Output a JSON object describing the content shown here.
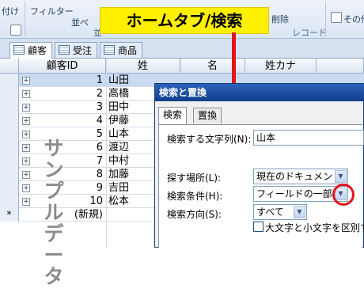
{
  "ribbon": {
    "left_text": "付け",
    "filter_label": "フィルター",
    "sort_label": "並べ",
    "group_label": "並",
    "delete_label": "削除",
    "record_group": "レコード",
    "find_partial": "その他"
  },
  "tabs": [
    {
      "label": "顧客"
    },
    {
      "label": "受注"
    },
    {
      "label": "商品"
    }
  ],
  "grid": {
    "headers": [
      "顧客ID",
      "姓",
      "名",
      "姓カナ"
    ],
    "new_row_label": "(新規)",
    "new_row_marker": "*",
    "rows": [
      {
        "id": "1",
        "last": "山田"
      },
      {
        "id": "2",
        "last": "高橋"
      },
      {
        "id": "3",
        "last": "田中"
      },
      {
        "id": "4",
        "last": "伊藤"
      },
      {
        "id": "5",
        "last": "山本"
      },
      {
        "id": "6",
        "last": "渡辺"
      },
      {
        "id": "7",
        "last": "中村"
      },
      {
        "id": "8",
        "last": "加藤"
      },
      {
        "id": "9",
        "last": "吉田"
      },
      {
        "id": "10",
        "last": "松本"
      }
    ],
    "watermark": "サンプルデータ"
  },
  "callout": {
    "text": "ホームタブ/検索"
  },
  "dialog": {
    "title": "検索と置換",
    "tab_find": "検索",
    "tab_replace": "置換",
    "find_what_label": "検索する文字列(N):",
    "find_what_value": "山本",
    "look_in_label": "探す場所(L):",
    "look_in_value": "現在のドキュメント",
    "match_label": "検索条件(H):",
    "match_value": "フィールドの一部分",
    "search_label": "検索方向(S):",
    "search_value": "すべて",
    "match_case_label": "大文字と小文字を区別する"
  },
  "colors": {
    "callout": "#fff000",
    "highlight": "#e3141b",
    "titlebar": "#1e4f9f"
  }
}
